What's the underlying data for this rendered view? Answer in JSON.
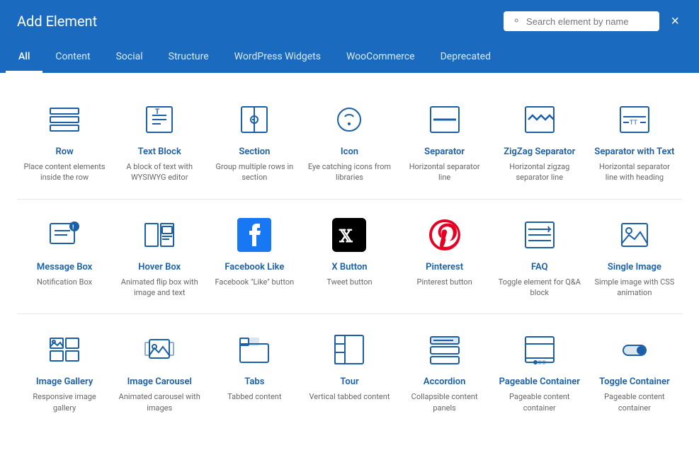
{
  "header": {
    "title": "Add Element",
    "search_placeholder": "Search element by name",
    "close_label": "×"
  },
  "tabs": [
    {
      "id": "all",
      "label": "All",
      "active": true
    },
    {
      "id": "content",
      "label": "Content",
      "active": false
    },
    {
      "id": "social",
      "label": "Social",
      "active": false
    },
    {
      "id": "structure",
      "label": "Structure",
      "active": false
    },
    {
      "id": "wordpress",
      "label": "WordPress Widgets",
      "active": false
    },
    {
      "id": "woocommerce",
      "label": "WooCommerce",
      "active": false
    },
    {
      "id": "deprecated",
      "label": "Deprecated",
      "active": false
    }
  ],
  "elements": [
    {
      "name": "Row",
      "desc": "Place content elements inside the row",
      "icon": "row"
    },
    {
      "name": "Text Block",
      "desc": "A block of text with WYSIWYG editor",
      "icon": "text-block"
    },
    {
      "name": "Section",
      "desc": "Group multiple rows in section",
      "icon": "section"
    },
    {
      "name": "Icon",
      "desc": "Eye catching icons from libraries",
      "icon": "icon"
    },
    {
      "name": "Separator",
      "desc": "Horizontal separator line",
      "icon": "separator"
    },
    {
      "name": "ZigZag Separator",
      "desc": "Horizontal zigzag separator line",
      "icon": "zigzag"
    },
    {
      "name": "Separator with Text",
      "desc": "Horizontal separator line with heading",
      "icon": "separator-text"
    },
    {
      "name": "Message Box",
      "desc": "Notification Box",
      "icon": "message-box"
    },
    {
      "name": "Hover Box",
      "desc": "Animated flip box with image and text",
      "icon": "hover-box"
    },
    {
      "name": "Facebook Like",
      "desc": "Facebook \"Like\" button",
      "icon": "facebook"
    },
    {
      "name": "X Button",
      "desc": "Tweet button",
      "icon": "x-button"
    },
    {
      "name": "Pinterest",
      "desc": "Pinterest button",
      "icon": "pinterest"
    },
    {
      "name": "FAQ",
      "desc": "Toggle element for Q&A block",
      "icon": "faq"
    },
    {
      "name": "Single Image",
      "desc": "Simple image with CSS animation",
      "icon": "single-image"
    },
    {
      "name": "Image Gallery",
      "desc": "Responsive image gallery",
      "icon": "image-gallery"
    },
    {
      "name": "Image Carousel",
      "desc": "Animated carousel with images",
      "icon": "image-carousel"
    },
    {
      "name": "Tabs",
      "desc": "Tabbed content",
      "icon": "tabs"
    },
    {
      "name": "Tour",
      "desc": "Vertical tabbed content",
      "icon": "tour"
    },
    {
      "name": "Accordion",
      "desc": "Collapsible content panels",
      "icon": "accordion"
    },
    {
      "name": "Pageable Container",
      "desc": "Pageable content container",
      "icon": "pageable"
    },
    {
      "name": "Toggle Container",
      "desc": "Pageable content container",
      "icon": "toggle"
    }
  ]
}
